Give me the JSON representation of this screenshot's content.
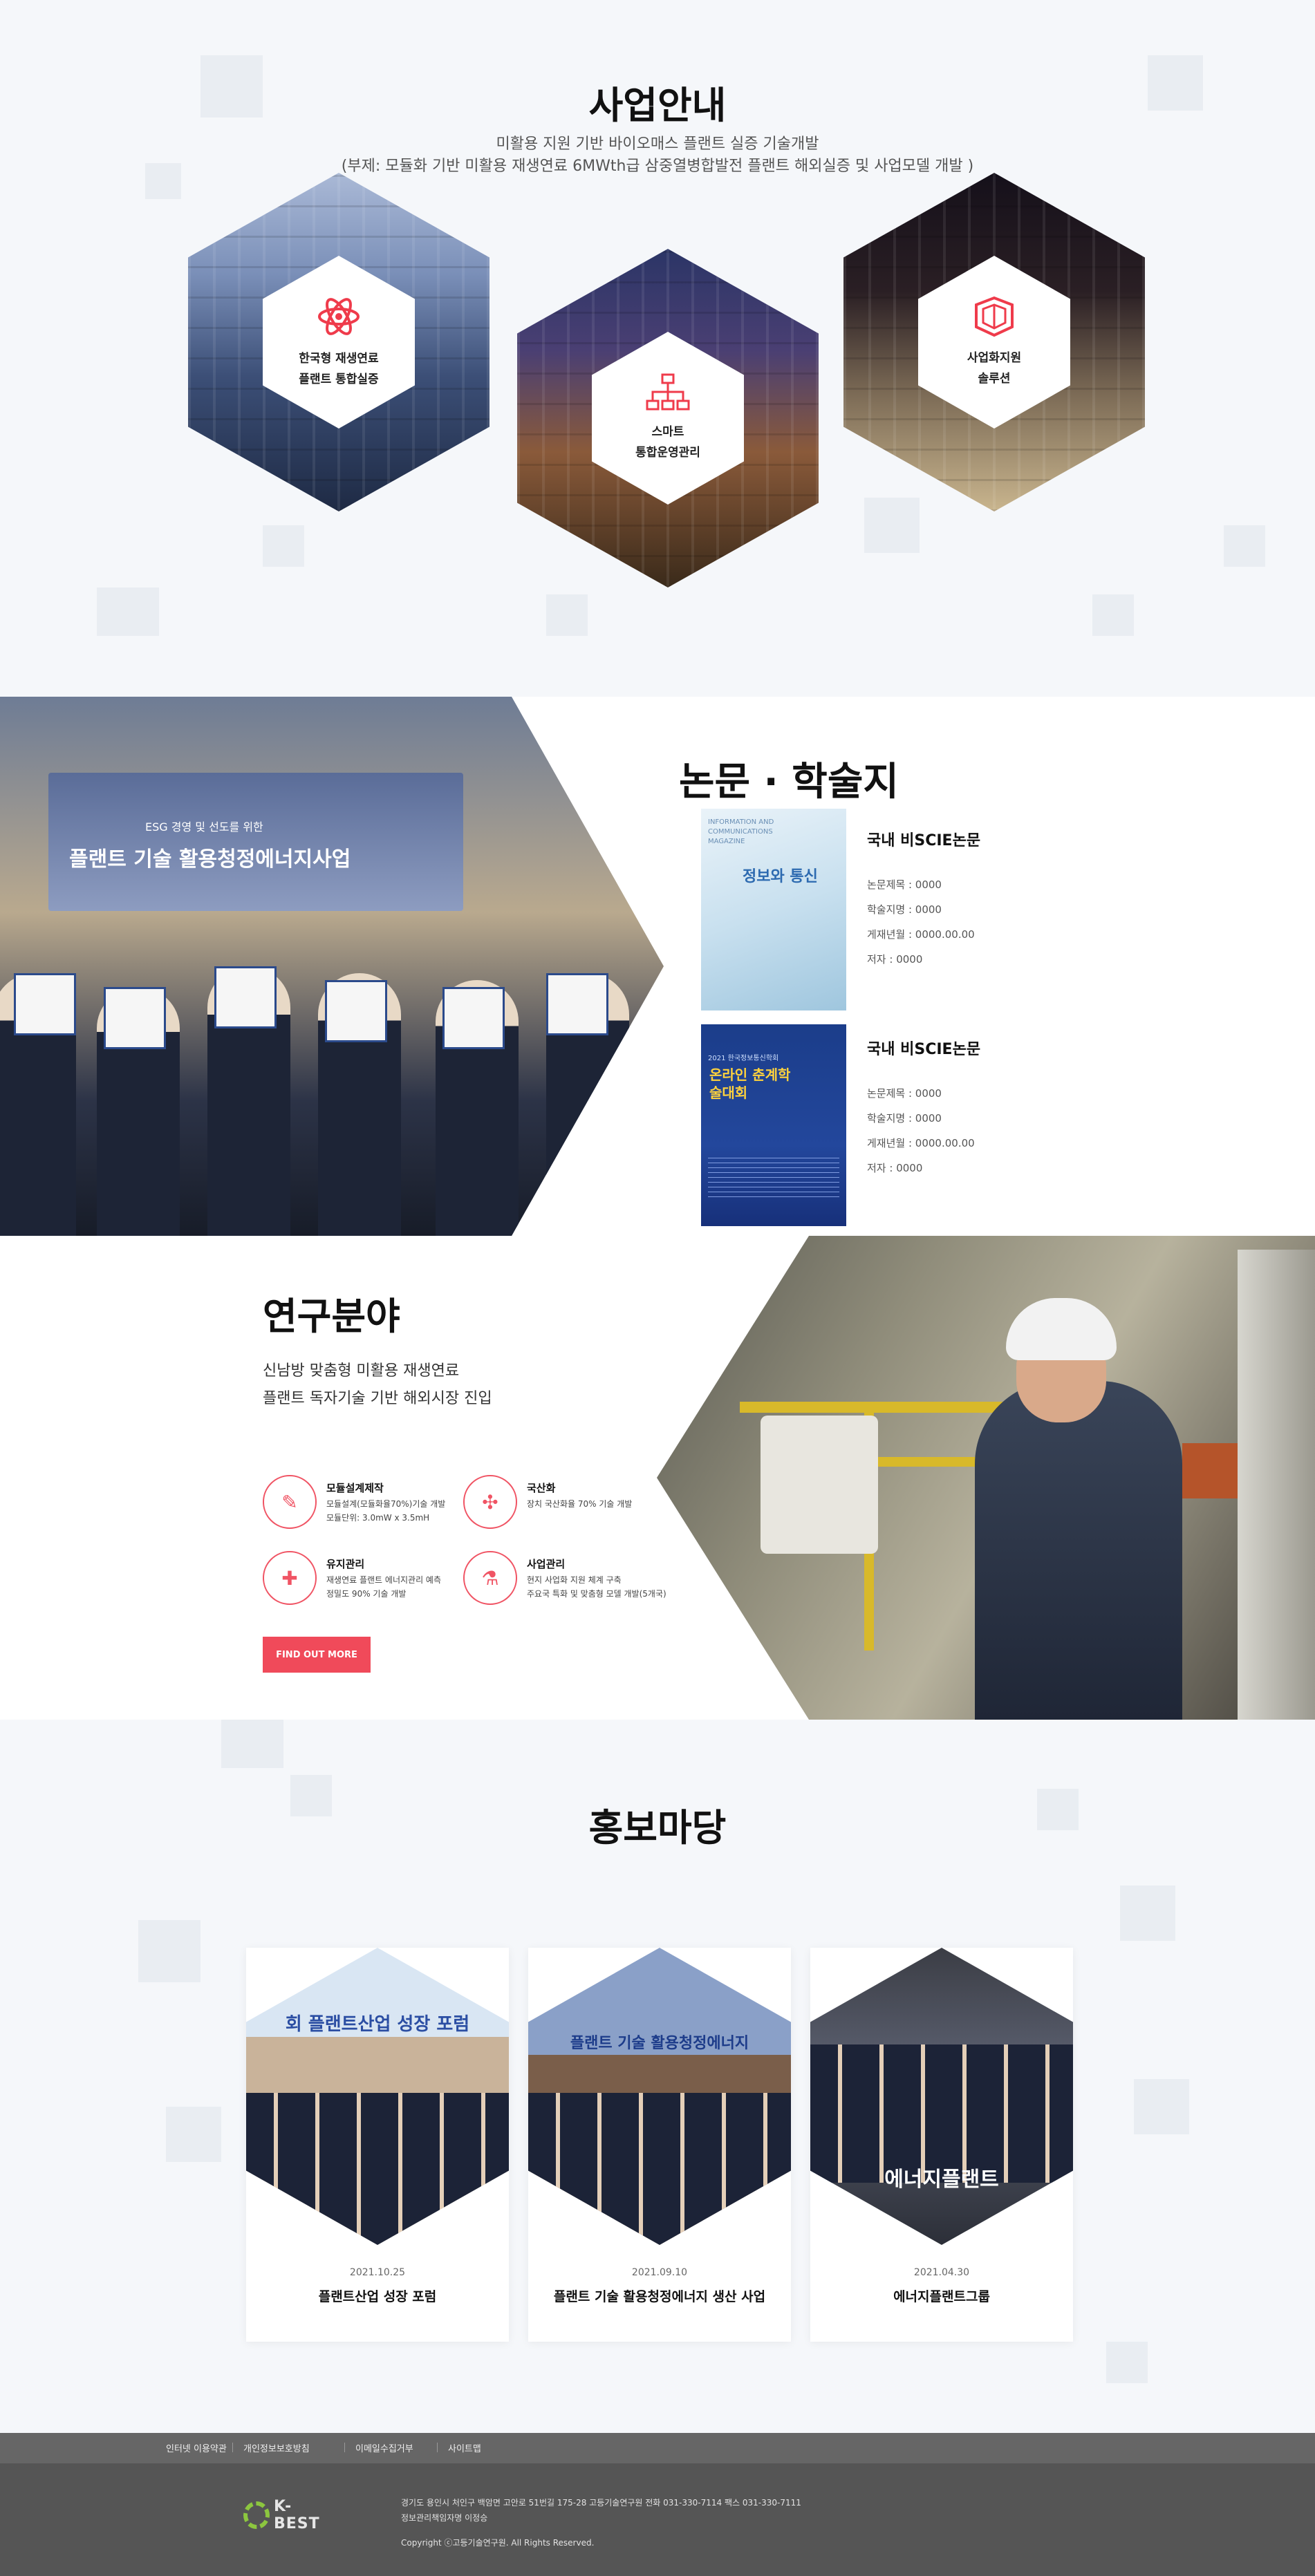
{
  "business": {
    "title": "사업안내",
    "subtitle1": "미활용 지원 기반 바이오매스 플랜트 실증 기술개발",
    "subtitle2": "(부제: 모듈화 기반 미활용 재생연료 6MWth급 삼중열병합발전 플랜트 해외실증 및 사업모델 개발 )",
    "items": [
      {
        "line1": "한국형 재생연료",
        "line2": "플랜트 통합실증",
        "icon": "atom-icon"
      },
      {
        "line1": "스마트",
        "line2": "통합운영관리",
        "icon": "hierarchy-icon"
      },
      {
        "line1": "사업화지원",
        "line2": "솔루션",
        "icon": "cube-icon"
      }
    ]
  },
  "papers": {
    "title": "논문 · 학술지",
    "banner_text": "플랜트 기술 활용청정에너지사업",
    "banner_top": "ESG 경영 및 선도를 위한",
    "items": [
      {
        "title": "국내 비SCIE논문",
        "cover_lines": [
          "INFORMATION AND",
          "COMMUNICATIONS",
          "MAGAZINE"
        ],
        "cover_big": "정보와 통신",
        "meta": [
          "논문제목 : 0000",
          "학술지명 : 0000",
          "게재년월 : 0000.00.00",
          "저자 : 0000"
        ]
      },
      {
        "title": "국내 비SCIE논문",
        "cover_lines": [
          "2021 한국정보통신학회"
        ],
        "cover_big": "온라인 춘계학술대회",
        "meta": [
          "논문제목 : 0000",
          "학술지명 : 0000",
          "게재년월 : 0000.00.00",
          "저자 : 0000"
        ]
      }
    ]
  },
  "research": {
    "title": "연구분야",
    "sub1": "신남방 맞춤형 미활용 재생연료",
    "sub2": "플랜트 독자기술 기반 해외시장 진입",
    "features": [
      {
        "title": "모듈설계제작",
        "desc1": "모듈설계(모듈화율70%)기술 개발",
        "desc2": "모듈단위: 3.0mW x 3.5mH",
        "icon": "pen-icon"
      },
      {
        "title": "국산화",
        "desc1": "장치 국산화율 70% 기술 개발",
        "desc2": "",
        "icon": "network-icon"
      },
      {
        "title": "유지관리",
        "desc1": "재생연료 플랜트 에너지관리 예측",
        "desc2": "정밀도 90% 기술 개발",
        "icon": "pills-icon"
      },
      {
        "title": "사업관리",
        "desc1": "현지 사업화 지원 체계 구축",
        "desc2": "주요국 특화 및 맞춤형 모델 개발(5개국)",
        "icon": "plant-icon"
      }
    ],
    "button": "FIND OUT MORE"
  },
  "pr": {
    "title": "홍보마당",
    "cards": [
      {
        "date": "2021.10.25",
        "title": "플랜트산업 성장 포럼",
        "banner": "회 플랜트산업 성장 포럼"
      },
      {
        "date": "2021.09.10",
        "title": "플랜트 기술 활용청정에너지 생산 사업",
        "banner": "플랜트 기술 활용청정에너지"
      },
      {
        "date": "2021.04.30",
        "title": "에너지플랜트그룹",
        "banner": "에너지플랜트"
      }
    ]
  },
  "footer": {
    "links": [
      "인터넷 이용약관",
      "개인정보보호방침",
      "이메일수집거부",
      "사이트맵"
    ],
    "logo": "K-BEST",
    "address": "경기도 용인시 처인구 백암면 고안로 51번길 175-28 고등기술연구원  전화 031-330-7114  팩스 031-330-7111",
    "privacy_officer": "정보관리책임자명 이정승",
    "copyright": "Copyright ⓒ고등기술연구원.  All Rights Reserved."
  },
  "colors": {
    "accent": "#f04a5a",
    "footer_dark": "#555555",
    "footer_bar": "#666666"
  }
}
